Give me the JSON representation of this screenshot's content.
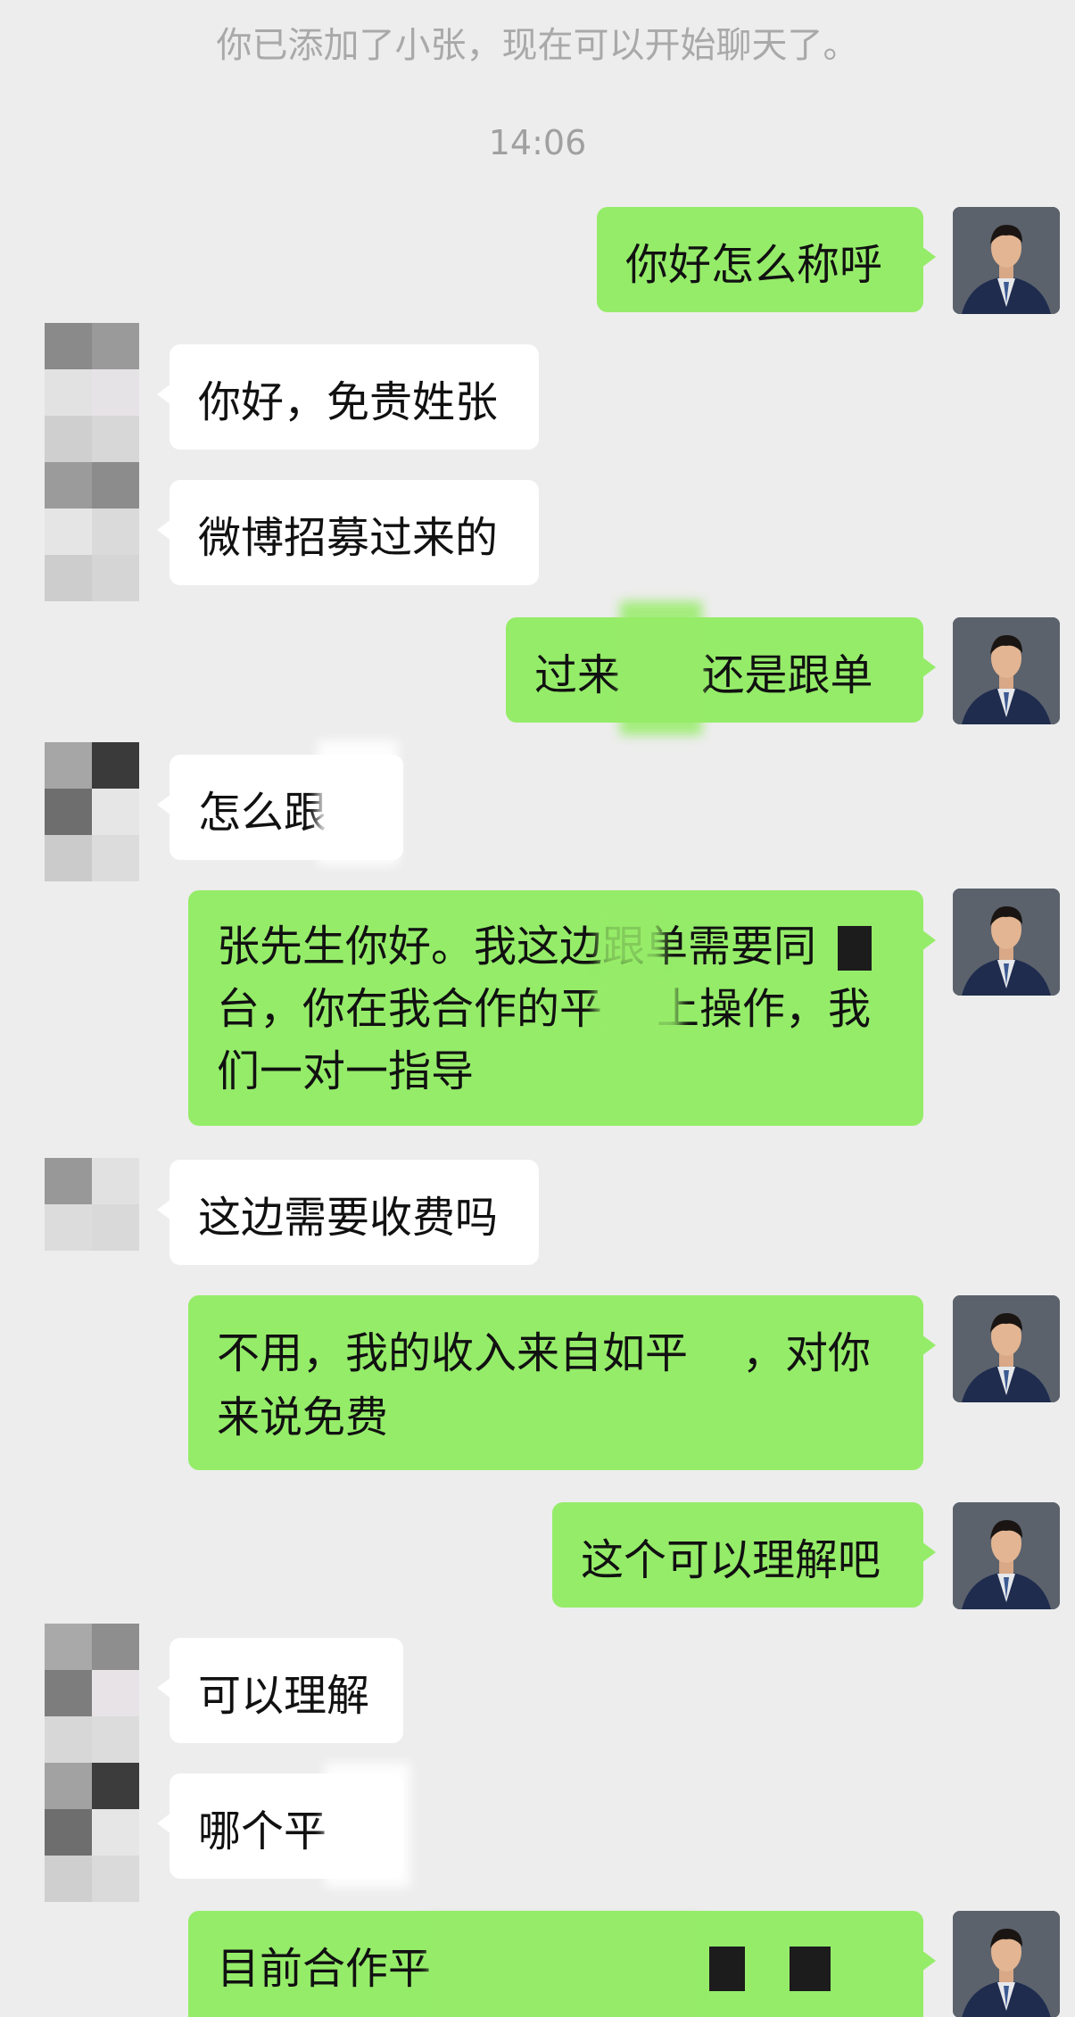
{
  "system_note": "你已添加了小张，现在可以开始聊天了。",
  "timestamp": "14:06",
  "messages": [
    {
      "side": "out",
      "text": "你好怎么称呼"
    },
    {
      "side": "in",
      "text": "你好，免贵姓张"
    },
    {
      "side": "in",
      "text": "微博招募过来的"
    },
    {
      "side": "out",
      "text": "过来      还是跟单"
    },
    {
      "side": "in",
      "text": "怎么跟"
    },
    {
      "side": "out",
      "text": "张先生你好。我这边跟单需要同\n台，你在我合作的平    上操作，我\n们一对一指导"
    },
    {
      "side": "in",
      "text": "这边需要收费吗"
    },
    {
      "side": "out",
      "text": "不用，我的收入来自如平    ，对你\n来说免费"
    },
    {
      "side": "out",
      "text": "这个可以理解吧"
    },
    {
      "side": "in",
      "text": "可以理解"
    },
    {
      "side": "in",
      "text": "哪个平"
    },
    {
      "side": "out",
      "text": "目前合作平"
    }
  ],
  "colors": {
    "background": "#ededed",
    "outgoing_bubble": "#95ec69",
    "incoming_bubble": "#ffffff"
  },
  "avatar_icons": {
    "self": "man-in-suit-avatar",
    "other": "mosaic-avatar"
  }
}
